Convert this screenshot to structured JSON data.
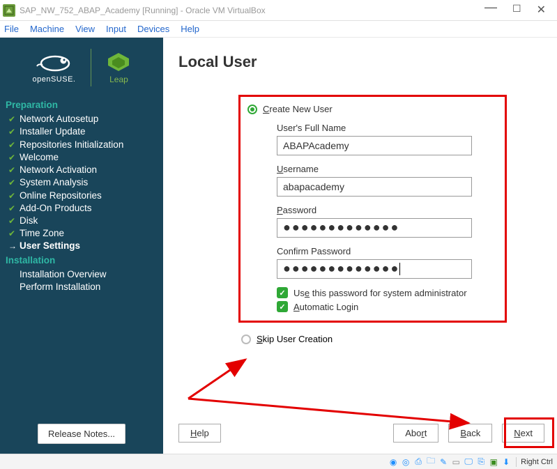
{
  "window": {
    "title": "SAP_NW_752_ABAP_Academy [Running] - Oracle VM VirtualBox"
  },
  "menubar": {
    "items": [
      "File",
      "Machine",
      "View",
      "Input",
      "Devices",
      "Help"
    ]
  },
  "sidebar": {
    "opensuse_label": "openSUSE.",
    "leap_label": "Leap",
    "sections": {
      "preparation": "Preparation",
      "installation": "Installation"
    },
    "prep_items": [
      "Network Autosetup",
      "Installer Update",
      "Repositories Initialization",
      "Welcome",
      "Network Activation",
      "System Analysis",
      "Online Repositories",
      "Add-On Products",
      "Disk",
      "Time Zone",
      "User Settings"
    ],
    "inst_items": [
      "Installation Overview",
      "Perform Installation"
    ],
    "release_notes": "Release Notes..."
  },
  "main": {
    "title": "Local User",
    "radio_create": "Create New User",
    "radio_create_u": "C",
    "fields": {
      "fullname_label": "User's Full Name",
      "fullname_value": "ABAPAcademy",
      "username_label": "Username",
      "username_u": "U",
      "username_value": "abapacademy",
      "password_label": "Password",
      "password_u": "P",
      "password_dots": "●●●●●●●●●●●●●",
      "confirm_label": "Confirm Password",
      "confirm_dots": "●●●●●●●●●●●●●"
    },
    "checks": {
      "sysadmin": "Use this password for system administrator",
      "sysadmin_u": "e",
      "autologin": "Automatic Login",
      "autologin_u": "A"
    },
    "radio_skip": "Skip User Creation",
    "radio_skip_u": "S"
  },
  "buttons": {
    "help": "Help",
    "help_u": "H",
    "abort": "Abort",
    "abort_u": "r",
    "back": "Back",
    "back_u": "B",
    "next": "Next",
    "next_u": "N"
  },
  "statusbar": {
    "text": "Right Ctrl"
  }
}
